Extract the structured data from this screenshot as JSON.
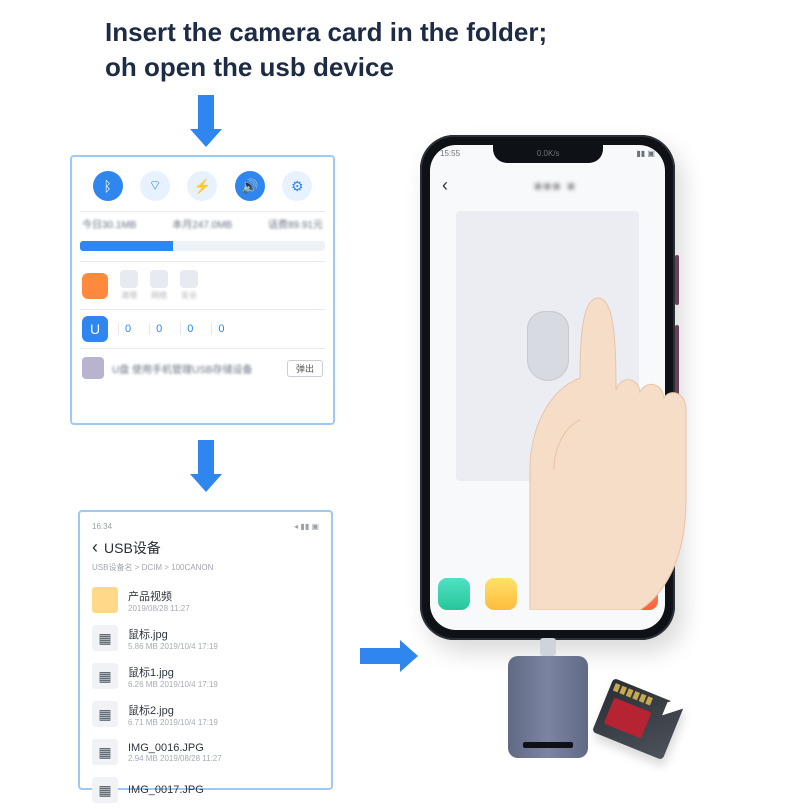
{
  "headline": {
    "line1": "Insert the camera card in the folder;",
    "line2": "oh open the usb device"
  },
  "panel1": {
    "usage_left": "今日30.1MB",
    "usage_mid": "本月247.0MB",
    "usage_right": "话费89.91元",
    "counts": [
      "0",
      "0",
      "0",
      "0"
    ],
    "eject_label": "弹出"
  },
  "panel2": {
    "time": "16:34",
    "title": "USB设备",
    "breadcrumb": "USB设备名 > DCIM > 100CANON",
    "files": [
      {
        "name": "产品视频",
        "sub": "2019/08/28 11:27",
        "kind": "folder"
      },
      {
        "name": "鼠标.jpg",
        "sub": "5.86 MB   2019/10/4 17:19",
        "kind": "img"
      },
      {
        "name": "鼠标1.jpg",
        "sub": "6.26 MB   2019/10/4 17:19",
        "kind": "img"
      },
      {
        "name": "鼠标2.jpg",
        "sub": "6.71 MB   2019/10/4 17:19",
        "kind": "img"
      },
      {
        "name": "IMG_0016.JPG",
        "sub": "2.94 MB   2019/08/28 11:27",
        "kind": "img"
      },
      {
        "name": "IMG_0017.JPG",
        "sub": "",
        "kind": "img"
      }
    ]
  },
  "phone": {
    "status_left": "15:55",
    "status_mid": "0.0K/s"
  }
}
